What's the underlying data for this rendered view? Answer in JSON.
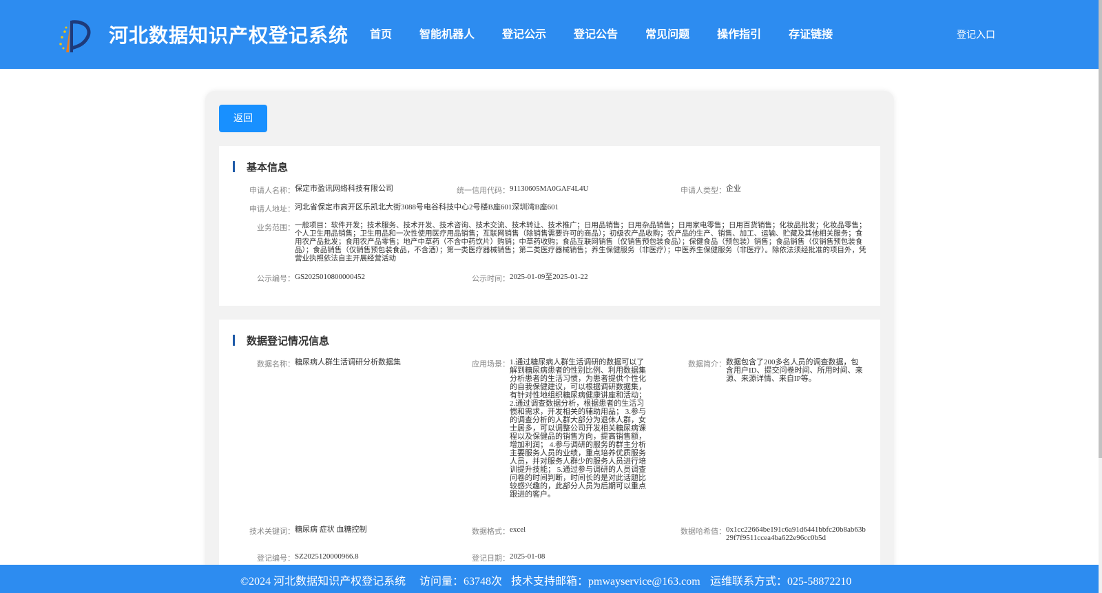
{
  "header": {
    "title": "河北数据知识产权登记系统",
    "nav": [
      "首页",
      "智能机器人",
      "登记公示",
      "登记公告",
      "常见问题",
      "操作指引",
      "存证链接"
    ],
    "login": "登记入口"
  },
  "back_label": "返回",
  "basic": {
    "title": "基本信息",
    "applicant_name_label": "申请人名称：",
    "applicant_name": "保定市盈讯网络科技有限公司",
    "credit_code_label": "统一信用代码：",
    "credit_code": "91130605MA0GAF4L4U",
    "applicant_type_label": "申请人类型：",
    "applicant_type": "企业",
    "address_label": "申请人地址：",
    "address": "河北省保定市高开区乐凯北大街3088号电谷科技中心2号楼B座601深圳湾B座601",
    "scope_label": "业务范围：",
    "scope": "一般项目：软件开发；技术服务、技术开发、技术咨询、技术交流、技术转让、技术推广；日用品销售；日用杂品销售；日用家电零售；日用百货销售；化妆品批发；化妆品零售；个人卫生用品销售；卫生用品和一次性使用医疗用品销售；互联网销售（除销售需要许可的商品）；初级农产品收购；农产品的生产、销售、加工、运输、贮藏及其他相关服务；食用农产品批发；食用农产品零售；地产中草药（不含中药饮片）购销；中草药收购；食品互联网销售（仅销售预包装食品）；保健食品（预包装）销售；食品销售（仅销售预包装食品）；食品销售（仅销售预包装食品，不含酒）；第一类医疗器械销售；第二类医疗器械销售；养生保健服务（非医疗）；中医养生保健服务（非医疗）。除依法须经批准的项目外，凭营业执照依法自主开展经营活动",
    "pub_no_label": "公示编号：",
    "pub_no": "GS2025010800000452",
    "pub_time_label": "公示时间：",
    "pub_time": "2025-01-09至2025-01-22"
  },
  "data_info": {
    "title": "数据登记情况信息",
    "name_label": "数据名称：",
    "name": "糖尿病人群生活调研分析数据集",
    "scene_label": "应用场景：",
    "scene": "1.通过糖尿病人群生活调研的数据可以了解到糖尿病患者的性别比例、利用数据集分析患者的生活习惯，为患者提供个性化的自我保健建议，可以根据调研数据集，有针对性地组织糖尿病健康讲座和活动； 2.通过调查数据分析，根据患者的生活习惯和需求，开发相关的辅助用品； 3.参与的调查分析的人群大部分为退休人群，女士居多，可以调整公司开发相关糖尿病课程以及保健品的销售方向，提高销售额，增加利润； 4.参与调研的服务的群主分析主要服务人员的业绩，重点培养优质服务人员，并对服务人群少的服务人员进行培训提升技能； 5.通过参与调研的人员调查问卷的时间判断，时间长的是对此话题比较感兴趣的，此部分人员为后期可以重点跟进的客户。",
    "intro_label": "数据简介：",
    "intro": "数据包含了200多名人员的调查数据，包含用户ID、提交问卷时间、所用时间、来源、来源详情、来自IP等。",
    "keywords_label": "技术关键词：",
    "keywords": "糖尿病 症状 血糖控制",
    "format_label": "数据格式：",
    "format": "excel",
    "hash_label": "数据哈希值：",
    "hash": "0x1cc22664be191c6a91d6441bbfc20b8ab63b29f7f9511ccea4ba622e96cc0b5d",
    "reg_no_label": "登记编号：",
    "reg_no": "SZ2025120000966.8",
    "reg_date_label": "登记日期：",
    "reg_date": "2025-01-08"
  },
  "footer": {
    "copyright": "©2024 河北数据知识产权登记系统",
    "visits": "访问量：63748次",
    "email": "技术支持邮箱：pmwayservice@163.com",
    "phone": "运维联系方式：025-58872210"
  },
  "colors": {
    "primary": "#2d8cf0",
    "button": "#1890ff",
    "accent_bar": "#1e5aa8"
  }
}
